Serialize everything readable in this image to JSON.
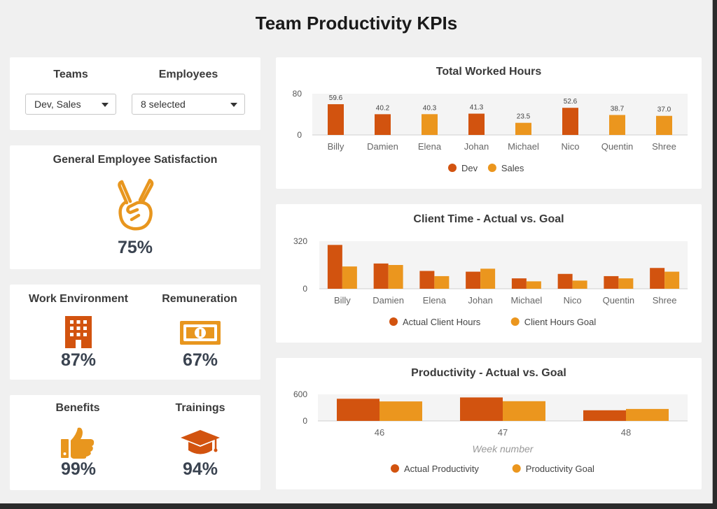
{
  "page": {
    "title": "Team Productivity KPIs"
  },
  "colors": {
    "dev": "#d2530f",
    "sales": "#eb961e",
    "icon_dark": "#d2530f",
    "icon_light": "#e8961e"
  },
  "filters": {
    "teams_label": "Teams",
    "teams_value": "Dev, Sales",
    "employees_label": "Employees",
    "employees_value": "8 selected"
  },
  "satisfaction": {
    "title": "General Employee Satisfaction",
    "icon": "peace-hand-icon",
    "value": "75%"
  },
  "kpis": [
    {
      "label": "Work Environment",
      "icon": "building-icon",
      "value": "87%"
    },
    {
      "label": "Remuneration",
      "icon": "banknote-icon",
      "value": "67%"
    },
    {
      "label": "Benefits",
      "icon": "thumbs-up-icon",
      "value": "99%"
    },
    {
      "label": "Trainings",
      "icon": "graduation-cap-icon",
      "value": "94%"
    }
  ],
  "chart_data": [
    {
      "type": "bar",
      "title": "Total Worked Hours",
      "categories": [
        "Billy",
        "Damien",
        "Elena",
        "Johan",
        "Michael",
        "Nico",
        "Quentin",
        "Shree"
      ],
      "series": [
        {
          "name": "Dev",
          "values": [
            59.6,
            40.2,
            null,
            41.3,
            null,
            52.6,
            null,
            null
          ]
        },
        {
          "name": "Sales",
          "values": [
            null,
            null,
            40.3,
            null,
            23.5,
            null,
            38.7,
            37.0
          ]
        }
      ],
      "data_labels": [
        "59.6",
        "40.2",
        "40.3",
        "41.3",
        "23.5",
        "52.6",
        "38.7",
        "37.0"
      ],
      "yticks": [
        "80",
        "0"
      ],
      "ylim": [
        0,
        80
      ],
      "legend": "bottom",
      "grid": false
    },
    {
      "type": "bar",
      "title": "Client Time - Actual vs. Goal",
      "categories": [
        "Billy",
        "Damien",
        "Elena",
        "Johan",
        "Michael",
        "Nico",
        "Quentin",
        "Shree"
      ],
      "series": [
        {
          "name": "Actual Client Hours",
          "values": [
            295,
            170,
            120,
            115,
            70,
            100,
            85,
            140
          ]
        },
        {
          "name": "Client Hours Goal",
          "values": [
            150,
            160,
            85,
            135,
            50,
            55,
            70,
            115
          ]
        }
      ],
      "yticks": [
        "320",
        "0"
      ],
      "ylim": [
        0,
        320
      ],
      "legend": "bottom",
      "grid": false
    },
    {
      "type": "bar",
      "title": "Productivity - Actual vs. Goal",
      "categories": [
        "46",
        "47",
        "48"
      ],
      "xlabel": "Week number",
      "series": [
        {
          "name": "Actual Productivity",
          "values": [
            500,
            530,
            240
          ]
        },
        {
          "name": "Productivity Goal",
          "values": [
            440,
            445,
            270
          ]
        }
      ],
      "yticks": [
        "600",
        "0"
      ],
      "ylim": [
        0,
        600
      ],
      "legend": "bottom",
      "grid": false
    }
  ]
}
